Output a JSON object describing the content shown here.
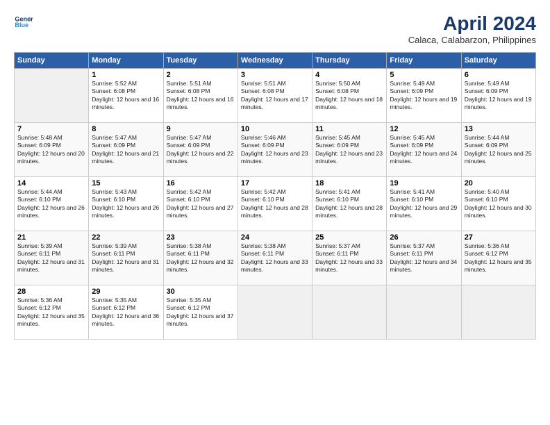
{
  "header": {
    "logo_line1": "General",
    "logo_line2": "Blue",
    "month_title": "April 2024",
    "subtitle": "Calaca, Calabarzon, Philippines"
  },
  "columns": [
    "Sunday",
    "Monday",
    "Tuesday",
    "Wednesday",
    "Thursday",
    "Friday",
    "Saturday"
  ],
  "weeks": [
    [
      {
        "num": "",
        "sunrise": "",
        "sunset": "",
        "daylight": ""
      },
      {
        "num": "1",
        "sunrise": "Sunrise: 5:52 AM",
        "sunset": "Sunset: 6:08 PM",
        "daylight": "Daylight: 12 hours and 16 minutes."
      },
      {
        "num": "2",
        "sunrise": "Sunrise: 5:51 AM",
        "sunset": "Sunset: 6:08 PM",
        "daylight": "Daylight: 12 hours and 16 minutes."
      },
      {
        "num": "3",
        "sunrise": "Sunrise: 5:51 AM",
        "sunset": "Sunset: 6:08 PM",
        "daylight": "Daylight: 12 hours and 17 minutes."
      },
      {
        "num": "4",
        "sunrise": "Sunrise: 5:50 AM",
        "sunset": "Sunset: 6:08 PM",
        "daylight": "Daylight: 12 hours and 18 minutes."
      },
      {
        "num": "5",
        "sunrise": "Sunrise: 5:49 AM",
        "sunset": "Sunset: 6:09 PM",
        "daylight": "Daylight: 12 hours and 19 minutes."
      },
      {
        "num": "6",
        "sunrise": "Sunrise: 5:49 AM",
        "sunset": "Sunset: 6:09 PM",
        "daylight": "Daylight: 12 hours and 19 minutes."
      }
    ],
    [
      {
        "num": "7",
        "sunrise": "Sunrise: 5:48 AM",
        "sunset": "Sunset: 6:09 PM",
        "daylight": "Daylight: 12 hours and 20 minutes."
      },
      {
        "num": "8",
        "sunrise": "Sunrise: 5:47 AM",
        "sunset": "Sunset: 6:09 PM",
        "daylight": "Daylight: 12 hours and 21 minutes."
      },
      {
        "num": "9",
        "sunrise": "Sunrise: 5:47 AM",
        "sunset": "Sunset: 6:09 PM",
        "daylight": "Daylight: 12 hours and 22 minutes."
      },
      {
        "num": "10",
        "sunrise": "Sunrise: 5:46 AM",
        "sunset": "Sunset: 6:09 PM",
        "daylight": "Daylight: 12 hours and 23 minutes."
      },
      {
        "num": "11",
        "sunrise": "Sunrise: 5:45 AM",
        "sunset": "Sunset: 6:09 PM",
        "daylight": "Daylight: 12 hours and 23 minutes."
      },
      {
        "num": "12",
        "sunrise": "Sunrise: 5:45 AM",
        "sunset": "Sunset: 6:09 PM",
        "daylight": "Daylight: 12 hours and 24 minutes."
      },
      {
        "num": "13",
        "sunrise": "Sunrise: 5:44 AM",
        "sunset": "Sunset: 6:09 PM",
        "daylight": "Daylight: 12 hours and 25 minutes."
      }
    ],
    [
      {
        "num": "14",
        "sunrise": "Sunrise: 5:44 AM",
        "sunset": "Sunset: 6:10 PM",
        "daylight": "Daylight: 12 hours and 26 minutes."
      },
      {
        "num": "15",
        "sunrise": "Sunrise: 5:43 AM",
        "sunset": "Sunset: 6:10 PM",
        "daylight": "Daylight: 12 hours and 26 minutes."
      },
      {
        "num": "16",
        "sunrise": "Sunrise: 5:42 AM",
        "sunset": "Sunset: 6:10 PM",
        "daylight": "Daylight: 12 hours and 27 minutes."
      },
      {
        "num": "17",
        "sunrise": "Sunrise: 5:42 AM",
        "sunset": "Sunset: 6:10 PM",
        "daylight": "Daylight: 12 hours and 28 minutes."
      },
      {
        "num": "18",
        "sunrise": "Sunrise: 5:41 AM",
        "sunset": "Sunset: 6:10 PM",
        "daylight": "Daylight: 12 hours and 28 minutes."
      },
      {
        "num": "19",
        "sunrise": "Sunrise: 5:41 AM",
        "sunset": "Sunset: 6:10 PM",
        "daylight": "Daylight: 12 hours and 29 minutes."
      },
      {
        "num": "20",
        "sunrise": "Sunrise: 5:40 AM",
        "sunset": "Sunset: 6:10 PM",
        "daylight": "Daylight: 12 hours and 30 minutes."
      }
    ],
    [
      {
        "num": "21",
        "sunrise": "Sunrise: 5:39 AM",
        "sunset": "Sunset: 6:11 PM",
        "daylight": "Daylight: 12 hours and 31 minutes."
      },
      {
        "num": "22",
        "sunrise": "Sunrise: 5:39 AM",
        "sunset": "Sunset: 6:11 PM",
        "daylight": "Daylight: 12 hours and 31 minutes."
      },
      {
        "num": "23",
        "sunrise": "Sunrise: 5:38 AM",
        "sunset": "Sunset: 6:11 PM",
        "daylight": "Daylight: 12 hours and 32 minutes."
      },
      {
        "num": "24",
        "sunrise": "Sunrise: 5:38 AM",
        "sunset": "Sunset: 6:11 PM",
        "daylight": "Daylight: 12 hours and 33 minutes."
      },
      {
        "num": "25",
        "sunrise": "Sunrise: 5:37 AM",
        "sunset": "Sunset: 6:11 PM",
        "daylight": "Daylight: 12 hours and 33 minutes."
      },
      {
        "num": "26",
        "sunrise": "Sunrise: 5:37 AM",
        "sunset": "Sunset: 6:11 PM",
        "daylight": "Daylight: 12 hours and 34 minutes."
      },
      {
        "num": "27",
        "sunrise": "Sunrise: 5:36 AM",
        "sunset": "Sunset: 6:12 PM",
        "daylight": "Daylight: 12 hours and 35 minutes."
      }
    ],
    [
      {
        "num": "28",
        "sunrise": "Sunrise: 5:36 AM",
        "sunset": "Sunset: 6:12 PM",
        "daylight": "Daylight: 12 hours and 35 minutes."
      },
      {
        "num": "29",
        "sunrise": "Sunrise: 5:35 AM",
        "sunset": "Sunset: 6:12 PM",
        "daylight": "Daylight: 12 hours and 36 minutes."
      },
      {
        "num": "30",
        "sunrise": "Sunrise: 5:35 AM",
        "sunset": "Sunset: 6:12 PM",
        "daylight": "Daylight: 12 hours and 37 minutes."
      },
      {
        "num": "",
        "sunrise": "",
        "sunset": "",
        "daylight": ""
      },
      {
        "num": "",
        "sunrise": "",
        "sunset": "",
        "daylight": ""
      },
      {
        "num": "",
        "sunrise": "",
        "sunset": "",
        "daylight": ""
      },
      {
        "num": "",
        "sunrise": "",
        "sunset": "",
        "daylight": ""
      }
    ]
  ]
}
